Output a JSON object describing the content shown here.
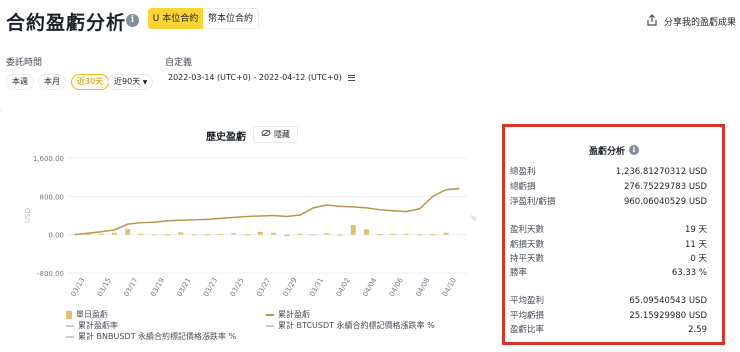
{
  "header": {
    "title": "合約盈虧分析",
    "tabs": [
      {
        "label": "U 本位合約",
        "selected": true
      },
      {
        "label": "幣本位合約",
        "selected": false
      }
    ],
    "share_label": "分享我的盈虧成果"
  },
  "filters": {
    "period_label": "委託時間",
    "custom_label": "自定義",
    "presets": [
      {
        "label": "本週",
        "selected": false
      },
      {
        "label": "本月",
        "selected": false
      },
      {
        "label": "近30天",
        "selected": true
      },
      {
        "label": "近90天",
        "selected": false
      }
    ],
    "date_range": "2022-03-14 (UTC+0)  -  2022-04-12 (UTC+0)"
  },
  "chart_section": {
    "title": "歷史盈虧",
    "hide_label": "隱藏"
  },
  "chart_data": {
    "type": "bar",
    "ylabel": "USD",
    "y_right_label": "%",
    "ylim": [
      -800,
      1600
    ],
    "yticks": [
      "1,600.00",
      "800.00",
      "0.00",
      "-800.00"
    ],
    "ytick_values": [
      1600,
      800,
      0,
      -800
    ],
    "x_tick_labels": [
      "03/13",
      "03/15",
      "03/17",
      "03/19",
      "03/21",
      "03/23",
      "03/25",
      "03/27",
      "03/29",
      "03/31",
      "04/02",
      "04/04",
      "04/06",
      "04/08",
      "04/10"
    ],
    "x": [
      "03/13",
      "03/14",
      "03/15",
      "03/16",
      "03/17",
      "03/18",
      "03/19",
      "03/20",
      "03/21",
      "03/22",
      "03/23",
      "03/24",
      "03/25",
      "03/26",
      "03/27",
      "03/28",
      "03/29",
      "03/30",
      "03/31",
      "04/01",
      "04/02",
      "04/03",
      "04/04",
      "04/05",
      "04/06",
      "04/07",
      "04/08",
      "04/09",
      "04/10",
      "04/11"
    ],
    "series": [
      {
        "name": "單日盈虧",
        "type": "bar",
        "color": "#e1c26c",
        "values": [
          0,
          10,
          20,
          40,
          120,
          20,
          5,
          10,
          50,
          5,
          10,
          15,
          30,
          10,
          60,
          40,
          -30,
          20,
          5,
          30,
          -20,
          200,
          110,
          10,
          20,
          20,
          5,
          10,
          40,
          0
        ]
      },
      {
        "name": "累計盈虧",
        "type": "line",
        "color": "#b9964e",
        "values": [
          0,
          30,
          60,
          100,
          220,
          250,
          260,
          290,
          300,
          310,
          320,
          340,
          360,
          380,
          390,
          400,
          380,
          410,
          560,
          620,
          590,
          580,
          560,
          520,
          500,
          480,
          540,
          800,
          940,
          960
        ]
      }
    ],
    "legend": [
      "單日盈虧",
      "累計盈虧",
      "累計盈虧率",
      "累計 BTCUSDT 永續合約標記價格漲跌率 %",
      "累計 BNBUSDT 永續合約標記價格漲跌率 %"
    ],
    "legend_placement": "bottom",
    "grid": true
  },
  "summary": {
    "title": "盈虧分析",
    "group1": [
      {
        "label": "總盈利",
        "value": "1,236.81270312 USD"
      },
      {
        "label": "總虧損",
        "value": "276.75229783 USD"
      },
      {
        "label": "淨盈利/虧損",
        "value": "960.06040529 USD"
      }
    ],
    "group2": [
      {
        "label": "盈利天數",
        "value": "19 天"
      },
      {
        "label": "虧損天數",
        "value": "11 天"
      },
      {
        "label": "持平天數",
        "value": "0 天"
      },
      {
        "label": "勝率",
        "value": "63.33 %"
      }
    ],
    "group3": [
      {
        "label": "平均盈利",
        "value": "65.09540543 USD"
      },
      {
        "label": "平均虧損",
        "value": "25.15929980 USD"
      },
      {
        "label": "盈虧比率",
        "value": "2.59"
      }
    ]
  },
  "colors": {
    "accent": "#fcd535",
    "bar": "#e1c26c",
    "line": "#b9964e",
    "highlight_border": "#d9342b"
  }
}
